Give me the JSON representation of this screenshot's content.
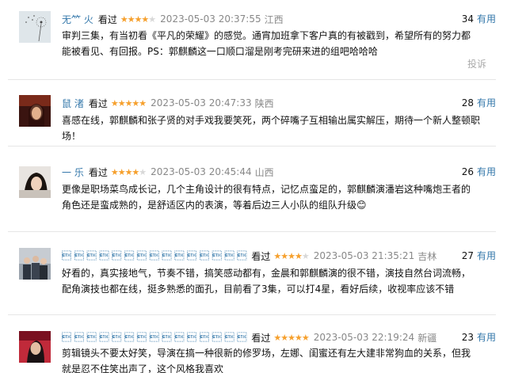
{
  "comments": [
    {
      "username": "无⺮ 火",
      "watched": "看过",
      "stars": 4,
      "time": "2023-05-03 20:37:55",
      "location": "江西",
      "votes": "34",
      "useful_label": "有用",
      "text": "审判三集，有当初看《平凡的荣耀》的感觉。通宵加班拿下客户真的有被戳到，希望所有的努力都能被看见、有回报。PS：郭麒麟这一口顺口溜是刚考完研来进的组吧哈哈哈",
      "report_label": "投诉",
      "avatar": "dandelion-avatar"
    },
    {
      "username": "鼠 渚",
      "watched": "看过",
      "stars": 5,
      "time": "2023-05-03 20:47:33",
      "location": "陕西",
      "votes": "28",
      "useful_label": "有用",
      "text": "喜感在线，郭麒麟和张子贤的对手戏我要笑死，两个碎嘴子互相输出属实解压，期待一个新人整顿职场！",
      "avatar": "woman-portrait-avatar"
    },
    {
      "username": "一 乐",
      "watched": "看过",
      "stars": 4,
      "time": "2023-05-03 20:45:44",
      "location": "山西",
      "votes": "26",
      "useful_label": "有用",
      "text": "更像是职场菜鸟成长记，几个主角设计的很有特点，记忆点蛮足的，郭麒麟演潘岩这种嘴炮王者的角色还是蛮成熟的，是舒适区内的表演，等着后边三人小队的组队升级😊",
      "avatar": "girl-portrait-avatar"
    },
    {
      "username": "\u0003 \u0003 \u0003 \u0003 \u0003 \u0003 \u0003 \u0003 \u0003 \u0003 \u0003 \u0003 \u0003 \u0003 \u0003 ",
      "watched": "看过",
      "stars": 4,
      "time": "2023-05-03 21:35:21",
      "location": "吉林",
      "votes": "27",
      "useful_label": "有用",
      "text": "好看的，真实接地气，节奏不错，搞笑感动都有，金晨和郭麒麟演的很不错，演技自然台词流畅，配角演技也都在线，挺多熟悉的面孔，目前看了3集，可以打4星，看好后续，收视率应该不错",
      "avatar": "group-photo-avatar"
    },
    {
      "username": "\u0003 \u0003 \u0003 \u0003 \u0003 \u0003 \u0003 \u0003 \u0003 \u0003 \u0003 \u0003 \u0003 \u0003 \u0003 ",
      "watched": "看过",
      "stars": 5,
      "time": "2023-05-03 22:19:24",
      "location": "新疆",
      "votes": "23",
      "useful_label": "有用",
      "text": "剪辑镜头不要太好笑，导演在搞一种很新的修罗场，左娜、闺蜜还有左大建非常狗血的关系，但我就是忍不住笑出声了，这个风格我喜欢",
      "avatar": "man-portrait-avatar"
    }
  ]
}
